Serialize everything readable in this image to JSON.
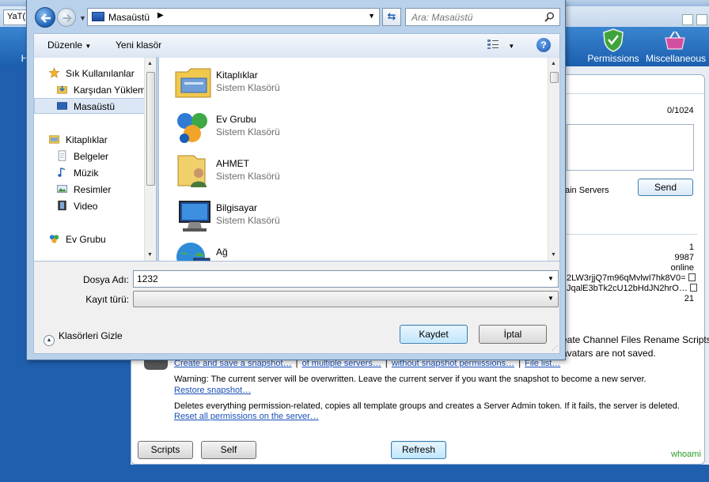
{
  "background_app": {
    "tab_label": "YaT(",
    "ribbon": {
      "left_glyph": "H",
      "dot": "o",
      "permissions": "Permissions",
      "miscellaneous": "Miscellaneous"
    },
    "counter": "0/1024",
    "main_servers_text": "ain Servers",
    "send_label": "Send",
    "info": {
      "row1": "1",
      "row2": "9987",
      "row3": "online",
      "row4": "2LW3rjjQ7m96qMvlwI7hk8V0=",
      "row5": "JqalE3bTk2cU12bHdJN2hrO…",
      "row6": "21"
    },
    "channel_files_text": "eate Channel Files Rename Scripts",
    "avatars_text": "avatars are not saved.",
    "snapshot": {
      "link_create": "Create and save a snapshot…",
      "link_multiple": "of multiple servers…",
      "link_without_perms": "without snapshot permissions…",
      "link_file_list": "File list…",
      "warning": "Warning: The current server will be overwritten. Leave the current server if you want the snapshot to become a new server.",
      "link_restore": "Restore snapshot…",
      "delete_text": "Deletes everything permission-related, copies all template groups and creates a Server Admin token. If it fails, the server is deleted.",
      "link_reset": "Reset all permissions on the server…"
    },
    "buttons": {
      "scripts": "Scripts",
      "self": "Self",
      "refresh": "Refresh"
    },
    "whoami": "whoami"
  },
  "dialog": {
    "address": "Masaüstü",
    "search_placeholder": "Ara: Masaüstü",
    "toolbar": {
      "organize": "Düzenle",
      "new_folder": "Yeni klasör"
    },
    "nav": {
      "favorites": "Sık Kullanılanlar",
      "downloads": "Karşıdan Yüklem",
      "desktop": "Masaüstü",
      "libraries": "Kitaplıklar",
      "documents": "Belgeler",
      "music": "Müzik",
      "pictures": "Resimler",
      "videos": "Video",
      "homegroup": "Ev Grubu"
    },
    "files": [
      {
        "name": "Kitaplıklar",
        "type": "Sistem Klasörü"
      },
      {
        "name": "Ev Grubu",
        "type": "Sistem Klasörü"
      },
      {
        "name": "AHMET",
        "type": "Sistem Klasörü"
      },
      {
        "name": "Bilgisayar",
        "type": "Sistem Klasörü"
      },
      {
        "name": "Ağ",
        "type": ""
      }
    ],
    "form": {
      "filename_label": "Dosya Adı:",
      "filename_value": "1232",
      "filetype_label": "Kayıt türü:",
      "filetype_value": ""
    },
    "hide_folders": "Klasörleri Gizle",
    "save_label": "Kaydet",
    "cancel_label": "İptal"
  }
}
